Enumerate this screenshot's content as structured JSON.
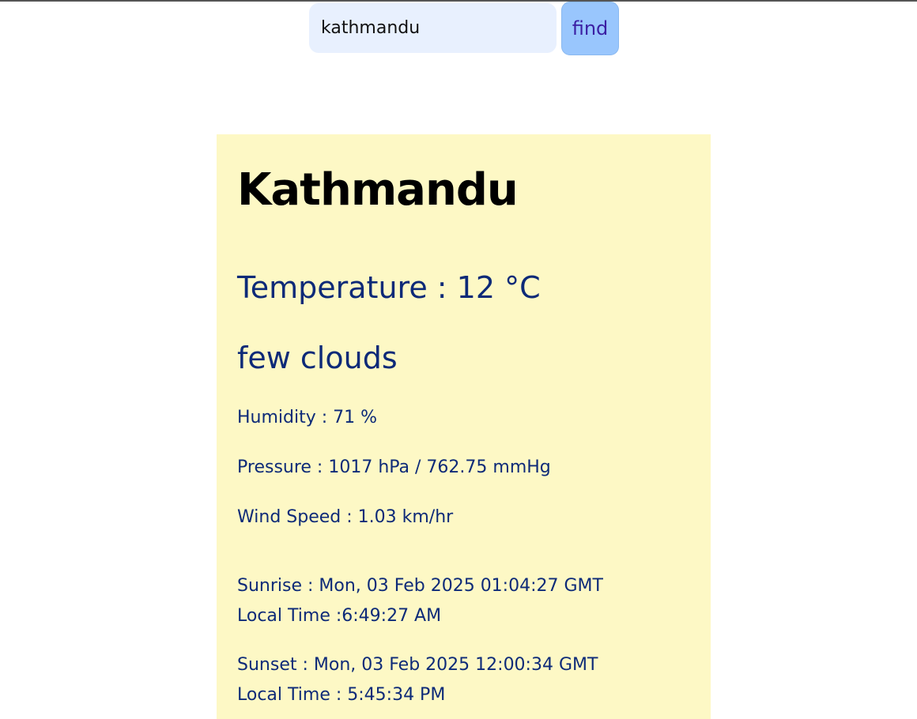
{
  "search": {
    "value": "kathmandu",
    "button_label": "find"
  },
  "weather": {
    "city": "Kathmandu",
    "temperature": "Temperature : 12 °C",
    "description": "few clouds",
    "humidity": "Humidity : 71 %",
    "pressure": "Pressure : 1017 hPa / 762.75 mmHg",
    "wind_speed": "Wind Speed : 1.03 km/hr",
    "sunrise": "Sunrise : Mon, 03 Feb 2025 01:04:27 GMT",
    "sunrise_local": "Local Time :6:49:27 AM",
    "sunset": "Sunset : Mon, 03 Feb 2025 12:00:34 GMT",
    "sunset_local": "Local Time : 5:45:34 PM"
  },
  "colors": {
    "card_background": "#fdf8c5",
    "text_primary": "#0d2a78",
    "button_background": "#99c6fd",
    "input_background": "#e8f0fe"
  }
}
